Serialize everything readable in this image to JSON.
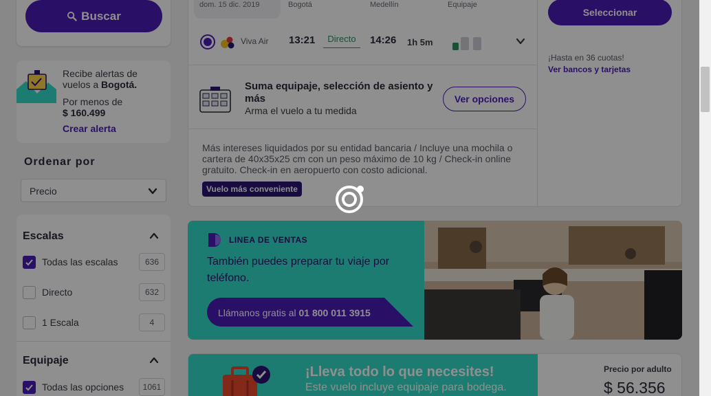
{
  "sidebar": {
    "search_label": "Buscar",
    "alert": {
      "line1": "Recibe alertas de",
      "line2_prefix": "vuelos a ",
      "city": "Bogotá.",
      "price_label": "Por menos de",
      "price": "$ 160.499",
      "link": "Crear alerta"
    },
    "order": {
      "title": "Ordenar por",
      "selected": "Precio"
    },
    "escalas": {
      "title": "Escalas",
      "options": [
        {
          "label": "Todas las escalas",
          "count": "636",
          "checked": true
        },
        {
          "label": "Directo",
          "count": "632",
          "checked": false
        },
        {
          "label": "1 Escala",
          "count": "4",
          "checked": false
        }
      ]
    },
    "equipaje": {
      "title": "Equipaje",
      "options": [
        {
          "label": "Todas las opciones",
          "count": "1061",
          "checked": true
        }
      ]
    }
  },
  "flight": {
    "headers": {
      "date": "dom. 15 dic. 2019",
      "origin": "Bogotá",
      "destination": "Medellín",
      "luggage": "Equipaje"
    },
    "airline": "Viva Air",
    "depart": "13:21",
    "stops": "Directo",
    "arrive": "14:26",
    "duration": "1h 5m",
    "upsell": {
      "title": "Suma equipaje, selección de asiento y más",
      "subtitle": "Arma el vuelo a tu medida",
      "button": "Ver opciones"
    },
    "policy": "Más intereses liquidados por su entidad bancaria / Incluye una mochila o cartera de 40x35x25 cm con un peso máximo de 10 kg / Check-in online gratuito. Check-in en aeropuerto con costo adicional.",
    "badge": "Vuelo más conveniente",
    "select_button": "Seleccionar",
    "cuotas": "¡Hasta en 36 cuotas!",
    "bancos": "Ver bancos y tarjetas"
  },
  "sales_banner": {
    "kicker": "LINEA DE VENTAS",
    "text": "También puedes preparar tu viaje por teléfono.",
    "call_prefix": "Llámanos gratis al ",
    "phone": "01 800 011 3915"
  },
  "promo": {
    "title": "¡Lleva todo lo que necesites!",
    "subtitle": "Este vuelo incluye equipaje para bodega.",
    "price_label": "Precio por adulto",
    "price": "$ 56.356"
  },
  "colors": {
    "brand": "#4c1cb8",
    "teal": "#35ddca",
    "navy": "#2a1470",
    "direct_green": "#2f8f5f"
  },
  "icons": [
    "search-icon",
    "bell-mail-icon",
    "chevron-down-icon",
    "chevron-up-icon",
    "check-icon",
    "airline-logo",
    "luggage-icon",
    "seat-map-icon",
    "phone-headset-icon",
    "suitcase-check-icon",
    "loading-spinner-icon"
  ]
}
